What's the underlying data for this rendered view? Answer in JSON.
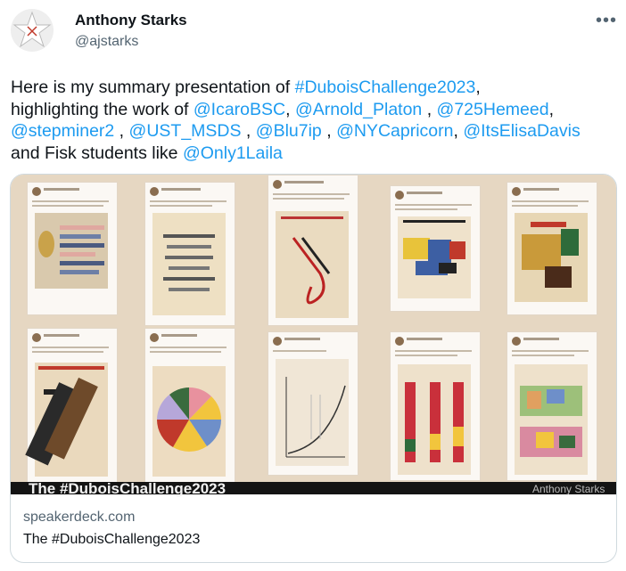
{
  "author": {
    "name": "Anthony Starks",
    "handle": "@ajstarks"
  },
  "more_icon": "more-horizontal-icon",
  "tweet": {
    "segments": [
      {
        "text": "Here is my summary presentation of ",
        "type": "text"
      },
      {
        "text": "#DuboisChallenge2023",
        "type": "link"
      },
      {
        "text": ",",
        "type": "text"
      },
      {
        "text": "highlighting the work of ",
        "type": "text"
      },
      {
        "text": "@IcaroBSC",
        "type": "link"
      },
      {
        "text": ", ",
        "type": "text"
      },
      {
        "text": "@Arnold_Platon",
        "type": "link"
      },
      {
        "text": " , ",
        "type": "text"
      },
      {
        "text": "@725Hemeed",
        "type": "link"
      },
      {
        "text": ",",
        "type": "text"
      },
      {
        "text": "@stepminer2",
        "type": "link"
      },
      {
        "text": " , ",
        "type": "text"
      },
      {
        "text": "@UST_MSDS",
        "type": "link"
      },
      {
        "text": " , ",
        "type": "text"
      },
      {
        "text": "@Blu7ip",
        "type": "link"
      },
      {
        "text": " , ",
        "type": "text"
      },
      {
        "text": "@NYCapricorn",
        "type": "link"
      },
      {
        "text": ", ",
        "type": "text"
      },
      {
        "text": "@ItsElisaDavis",
        "type": "link"
      },
      {
        "text": "and Fisk students like ",
        "type": "text"
      },
      {
        "text": "@Only1Laila",
        "type": "link"
      }
    ]
  },
  "card": {
    "domain": "speakerdeck.com",
    "title": "The #DuboisChallenge2023",
    "slide_caption": "The #DuboisChallenge2023",
    "slide_author": "Anthony Starks"
  },
  "colors": {
    "link": "#1d9bf0",
    "text": "#0f1419",
    "muted": "#536471",
    "slide_bg": "#e6d7c2"
  }
}
